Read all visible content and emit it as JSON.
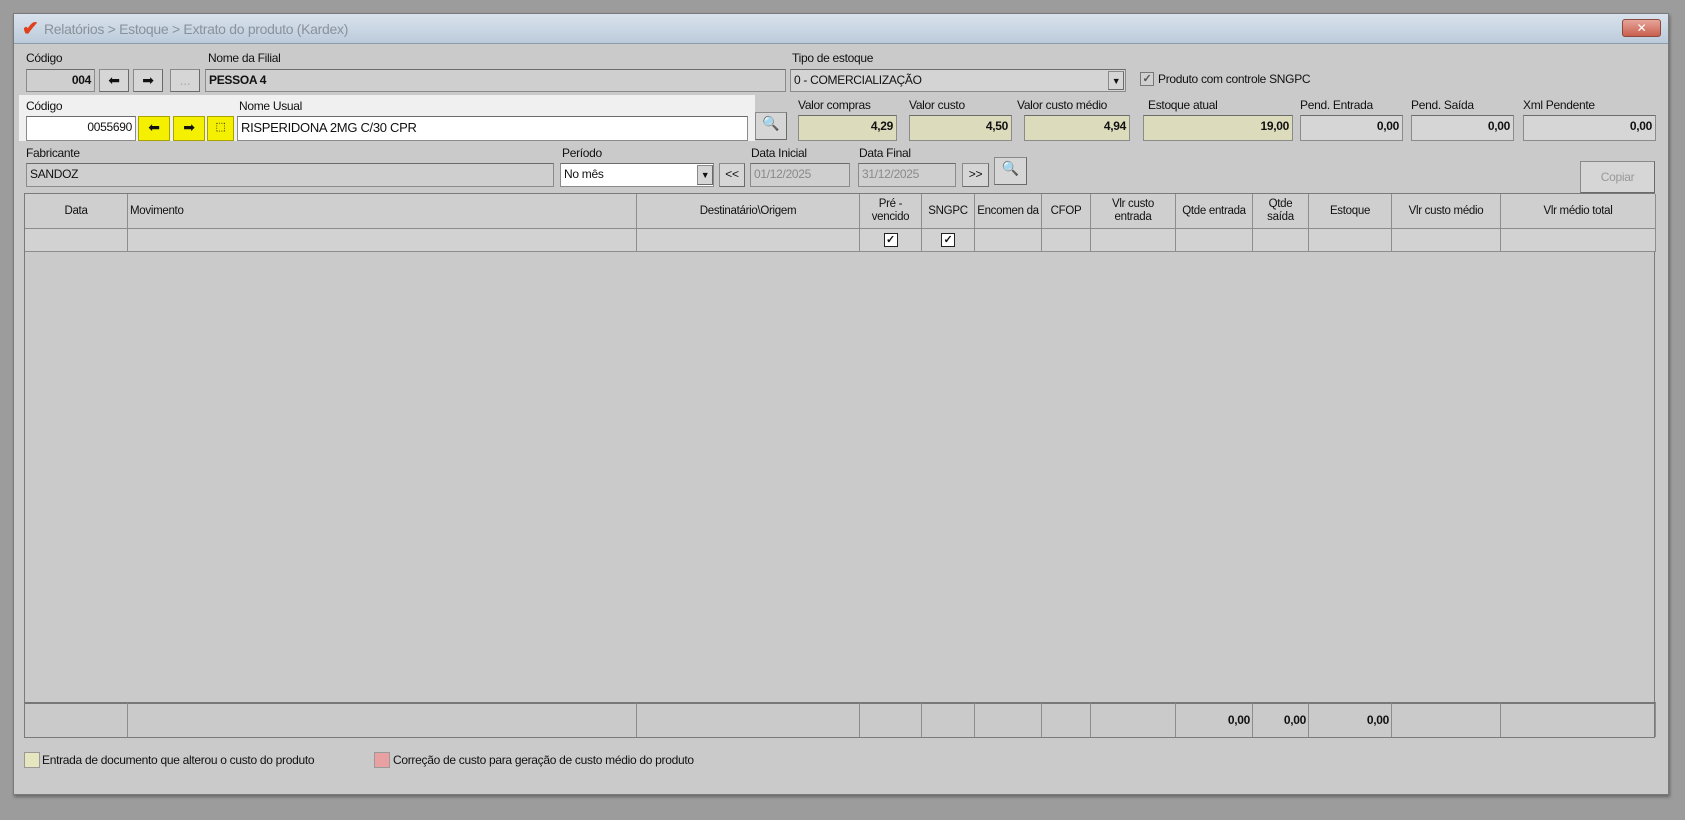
{
  "window": {
    "title": "Relatórios > Estoque > Extrato do produto (Kardex)",
    "close_icon": "close-icon",
    "logo_color": "#e0401c"
  },
  "filial": {
    "codigo_label": "Código",
    "codigo_value": "004",
    "nome_label": "Nome da Filial",
    "nome_value": "PESSOA 4",
    "ellipsis_label": "..."
  },
  "tipo_estoque": {
    "label": "Tipo de estoque",
    "value": "0 - COMERCIALIZAÇÃO"
  },
  "sngpc_checkbox": {
    "label": "Produto com controle SNGPC",
    "checked": true
  },
  "produto": {
    "codigo_label": "Código",
    "codigo_value": "0055690",
    "nome_label": "Nome Usual",
    "nome_value": "RISPERIDONA 2MG C/30 CPR",
    "highlight_color": "#f4f000"
  },
  "valores": [
    {
      "label": "Valor compras",
      "value": "4,29"
    },
    {
      "label": "Valor custo",
      "value": "4,50"
    },
    {
      "label": "Valor custo médio",
      "value": "4,94"
    },
    {
      "label": "Estoque atual",
      "value": "19,00"
    },
    {
      "label": "Pend. Entrada",
      "value": "0,00"
    },
    {
      "label": "Pend. Saída",
      "value": "0,00"
    },
    {
      "label": "Xml Pendente",
      "value": "0,00"
    }
  ],
  "fabricante": {
    "label": "Fabricante",
    "value": "SANDOZ"
  },
  "periodo": {
    "label": "Período",
    "value": "No mês",
    "prev_label": "<<",
    "next_label": ">>"
  },
  "data_inicial": {
    "label": "Data Inicial",
    "value": "01/12/2025"
  },
  "data_final": {
    "label": "Data Final",
    "value": "31/12/2025"
  },
  "copiar_label": "Copiar",
  "grid": {
    "columns": [
      "Data",
      "Movimento",
      "Destinatário\\Origem",
      "Pré - vencido",
      "SNGPC",
      "Encomen da",
      "CFOP",
      "Vlr custo entrada",
      "Qtde entrada",
      "Qtde saída",
      "Estoque",
      "Vlr custo médio",
      "Vlr médio total"
    ],
    "first_row_checks": {
      "Pré - vencido": true,
      "SNGPC": true
    },
    "totals": {
      "Qtde entrada": "0,00",
      "Qtde saída": "0,00",
      "Estoque": "0,00"
    }
  },
  "legend": [
    {
      "label": "Entrada de documento que alterou o custo do produto",
      "color": "#e6e6c0"
    },
    {
      "label": "Correção de custo para geração de custo médio do produto",
      "color": "#e8a0a0"
    }
  ]
}
